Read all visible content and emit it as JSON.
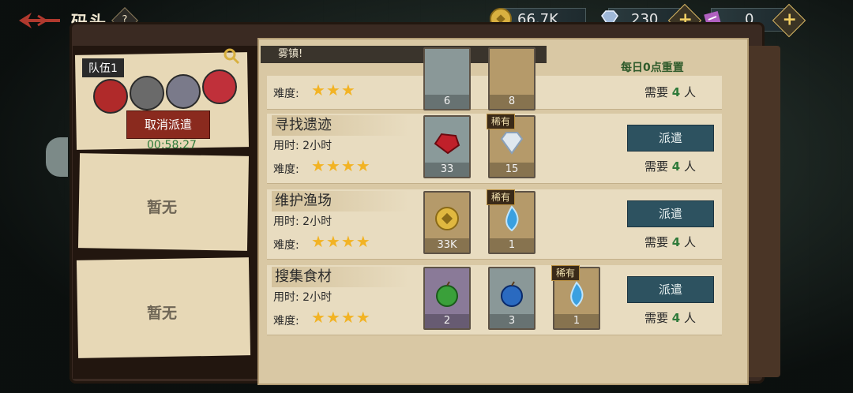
{
  "header": {
    "title": "码头",
    "help_label": "?"
  },
  "resources": [
    {
      "name": "coin",
      "value": "66.7K",
      "color": "#d8b040"
    },
    {
      "name": "diamond",
      "value": "230",
      "color": "#9fb8d8"
    },
    {
      "name": "ticket",
      "value": "0",
      "color": "#b060c0"
    }
  ],
  "banner": "雾镇!",
  "reset_text": "每日0点重置",
  "teams": [
    {
      "label": "队伍1",
      "cancel_label": "取消派遣",
      "timer": "00:58:27"
    },
    {
      "empty_label": "暂无"
    },
    {
      "empty_label": "暂无"
    }
  ],
  "missions": [
    {
      "name": "",
      "time_label": "",
      "difficulty_label": "难度:",
      "stars": "★★★",
      "need_prefix": "需要",
      "need_count": "4",
      "need_suffix": "人",
      "items": [
        {
          "count": "6",
          "color": "#8a9898"
        },
        {
          "count": "8",
          "color": "#8a9898"
        }
      ]
    },
    {
      "name": "寻找遗迹",
      "time_label": "用时:  2小时",
      "difficulty_label": "难度:",
      "stars": "★★★★",
      "need_prefix": "需要",
      "need_count": "4",
      "need_suffix": "人",
      "dispatch_label": "派遣",
      "items": [
        {
          "count": "33",
          "color": "#8a9a9a",
          "icon": "ruby-icon"
        },
        {
          "count": "15",
          "color": "#b59a6a",
          "rare": "稀有",
          "icon": "diamond-icon"
        }
      ]
    },
    {
      "name": "维护渔场",
      "time_label": "用时:  2小时",
      "difficulty_label": "难度:",
      "stars": "★★★★",
      "need_prefix": "需要",
      "need_count": "4",
      "need_suffix": "人",
      "dispatch_label": "派遣",
      "items": [
        {
          "count": "33K",
          "color": "#b59a6a",
          "icon": "coin-icon"
        },
        {
          "count": "1",
          "color": "#b59a6a",
          "rare": "稀有",
          "icon": "blue-flame-icon"
        }
      ]
    },
    {
      "name": "搜集食材",
      "time_label": "用时:  2小时",
      "difficulty_label": "难度:",
      "stars": "★★★★",
      "need_prefix": "需要",
      "need_count": "4",
      "need_suffix": "人",
      "dispatch_label": "派遣",
      "items": [
        {
          "count": "2",
          "color": "#8a7a98",
          "icon": "green-apple-icon"
        },
        {
          "count": "3",
          "color": "#8a9898",
          "icon": "blue-apple-icon"
        },
        {
          "count": "1",
          "color": "#b59a6a",
          "rare": "稀有",
          "icon": "blue-flame-icon"
        }
      ]
    }
  ]
}
